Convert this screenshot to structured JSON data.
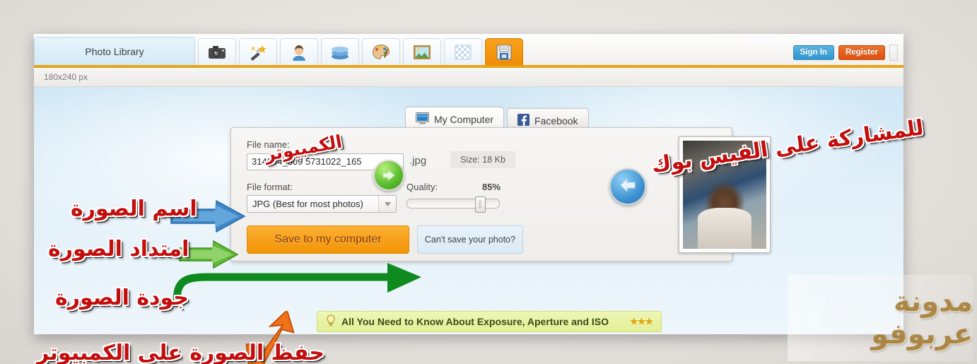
{
  "app": {
    "title": "Photo Library",
    "status": "180x240 px"
  },
  "toolbar": {
    "icons": [
      {
        "name": "camera-icon",
        "label": "Camera"
      },
      {
        "name": "magic-wand-icon",
        "label": "Auto Fix"
      },
      {
        "name": "portrait-icon",
        "label": "Portrait"
      },
      {
        "name": "layers-icon",
        "label": "Layers"
      },
      {
        "name": "palette-icon",
        "label": "Effects"
      },
      {
        "name": "frame-icon",
        "label": "Frames"
      },
      {
        "name": "texture-icon",
        "label": "Textures"
      },
      {
        "name": "save-floppy-icon",
        "label": "Save"
      }
    ],
    "active_index": 7
  },
  "auth": {
    "sign_in": "Sign In",
    "register": "Register"
  },
  "tabs": [
    {
      "label": "My Computer",
      "icon": "monitor-icon",
      "active": true
    },
    {
      "label": "Facebook",
      "icon": "facebook-icon",
      "active": false
    }
  ],
  "dialog": {
    "filename_label": "File name:",
    "filename_value": "314904_309     5731022_165",
    "file_extension": ".jpg",
    "file_size": "Size: 18 Kb",
    "fileformat_label": "File format:",
    "fileformat_value": "JPG (Best for most photos)",
    "quality_label": "Quality:",
    "quality_value": "85%",
    "save_button": "Save to my computer",
    "cant_save_button": "Can't save your photo?"
  },
  "tip": {
    "text": "All You Need to Know About Exposure, Aperture and ISO",
    "stars": "★★★"
  },
  "annotations": {
    "image_name": "اسم الصورة",
    "image_extension": "امتداد الصورة",
    "image_quality": "جودة الصورة",
    "computer": "الكمبيوتر",
    "share_facebook": "للمشاركة على الفيس بوك",
    "bottom_cut": "حفظ الصورة على الكمبيوتر"
  },
  "watermark": {
    "text": "مدونة عربوفو"
  },
  "colors": {
    "accent_orange": "#e8a317",
    "save_orange": "#f29406",
    "signin_blue": "#2f95d0",
    "register_orange": "#dd4e10",
    "tip_yellow": "#e2ef96",
    "annotation_red": "#c40d0d"
  }
}
